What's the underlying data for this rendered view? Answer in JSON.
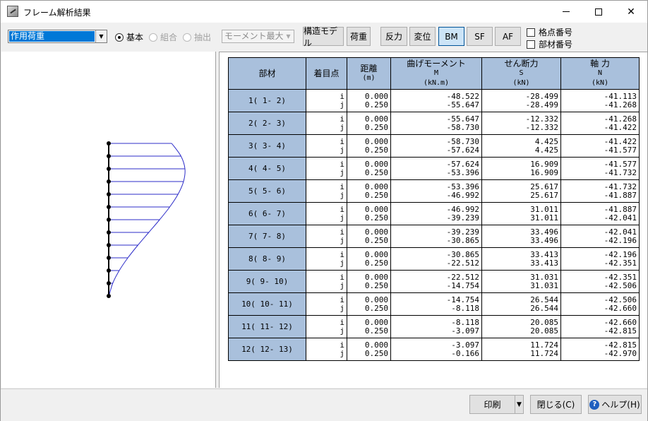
{
  "window": {
    "title": "フレーム解析結果"
  },
  "toolbar": {
    "load_case": "作用荷重",
    "radios": [
      {
        "label": "基本",
        "selected": true,
        "enabled": true
      },
      {
        "label": "組合",
        "selected": false,
        "enabled": false
      },
      {
        "label": "抽出",
        "selected": false,
        "enabled": false
      }
    ],
    "extract_select": "モーメント最大",
    "buttons": {
      "structure_model": "構造モデル",
      "load": "荷重",
      "reaction": "反力",
      "displacement": "変位",
      "bm": "BM",
      "sf": "SF",
      "af": "AF"
    },
    "active_button": "BM",
    "checkboxes": {
      "node_number": "格点番号",
      "member_number": "部材番号"
    }
  },
  "table": {
    "headers": {
      "member": "部材",
      "point": "着目点",
      "distance": "距離",
      "distance_unit": "(m)",
      "moment": "曲げモーメント",
      "moment_sym": "M",
      "moment_unit": "(kN.m)",
      "shear": "せん断力",
      "shear_sym": "S",
      "shear_unit": "(kN)",
      "axial": "軸 力",
      "axial_sym": "N",
      "axial_unit": "(kN)"
    },
    "rows": [
      {
        "member": "1( 1- 2)",
        "point": "i\nj",
        "dist": "0.000\n0.250",
        "M": "-48.522\n-55.647",
        "S": "-28.499\n-28.499",
        "N": "-41.113\n-41.268"
      },
      {
        "member": "2( 2- 3)",
        "point": "i\nj",
        "dist": "0.000\n0.250",
        "M": "-55.647\n-58.730",
        "S": "-12.332\n-12.332",
        "N": "-41.268\n-41.422"
      },
      {
        "member": "3( 3- 4)",
        "point": "i\nj",
        "dist": "0.000\n0.250",
        "M": "-58.730\n-57.624",
        "S": "4.425\n4.425",
        "N": "-41.422\n-41.577"
      },
      {
        "member": "4( 4- 5)",
        "point": "i\nj",
        "dist": "0.000\n0.250",
        "M": "-57.624\n-53.396",
        "S": "16.909\n16.909",
        "N": "-41.577\n-41.732"
      },
      {
        "member": "5( 5- 6)",
        "point": "i\nj",
        "dist": "0.000\n0.250",
        "M": "-53.396\n-46.992",
        "S": "25.617\n25.617",
        "N": "-41.732\n-41.887"
      },
      {
        "member": "6( 6- 7)",
        "point": "i\nj",
        "dist": "0.000\n0.250",
        "M": "-46.992\n-39.239",
        "S": "31.011\n31.011",
        "N": "-41.887\n-42.041"
      },
      {
        "member": "7( 7- 8)",
        "point": "i\nj",
        "dist": "0.000\n0.250",
        "M": "-39.239\n-30.865",
        "S": "33.496\n33.496",
        "N": "-42.041\n-42.196"
      },
      {
        "member": "8( 8- 9)",
        "point": "i\nj",
        "dist": "0.000\n0.250",
        "M": "-30.865\n-22.512",
        "S": "33.413\n33.413",
        "N": "-42.196\n-42.351"
      },
      {
        "member": "9( 9- 10)",
        "point": "i\nj",
        "dist": "0.000\n0.250",
        "M": "-22.512\n-14.754",
        "S": "31.031\n31.031",
        "N": "-42.351\n-42.506"
      },
      {
        "member": "10( 10- 11)",
        "point": "i\nj",
        "dist": "0.000\n0.250",
        "M": "-14.754\n-8.118",
        "S": "26.544\n26.544",
        "N": "-42.506\n-42.660"
      },
      {
        "member": "11( 11- 12)",
        "point": "i\nj",
        "dist": "0.000\n0.250",
        "M": "-8.118\n-3.097",
        "S": "20.085\n20.085",
        "N": "-42.660\n-42.815"
      },
      {
        "member": "12( 12- 13)",
        "point": "i\nj",
        "dist": "0.000\n0.250",
        "M": "-3.097\n-0.166",
        "S": "11.724\n11.724",
        "N": "-42.815\n-42.970"
      }
    ]
  },
  "diagram": {
    "node_moments": [
      48.522,
      55.647,
      58.73,
      57.624,
      53.396,
      46.992,
      39.239,
      30.865,
      22.512,
      14.754,
      8.118,
      3.097,
      0.166
    ],
    "line_color": "#2c2cc8",
    "member_color": "#000000"
  },
  "footer": {
    "print": "印刷",
    "close": "閉じる(C)",
    "help": "ヘルプ(H)"
  }
}
